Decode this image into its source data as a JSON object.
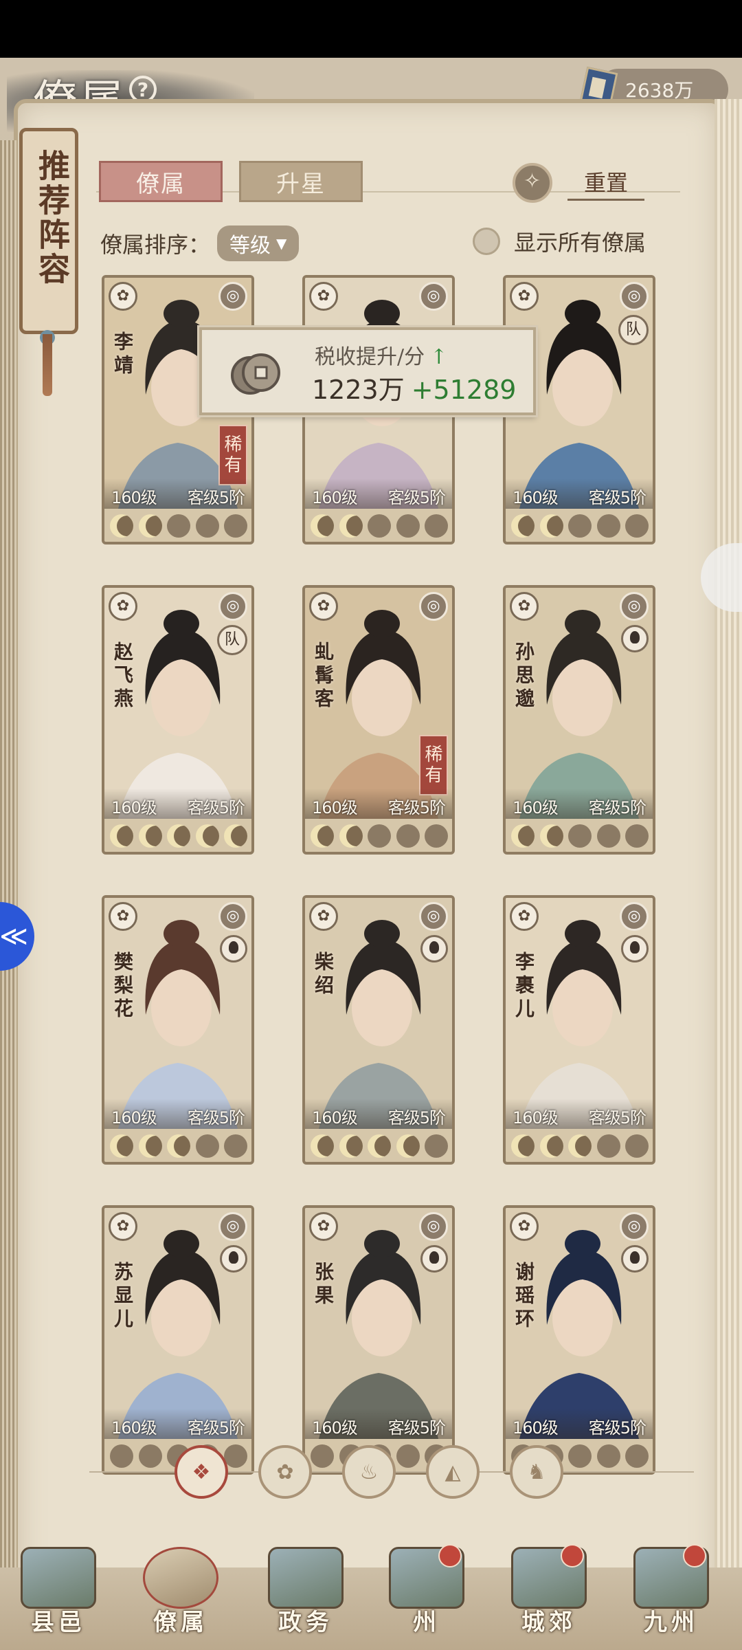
{
  "header": {
    "title": "僚属",
    "help": "?",
    "currency_value": "2638万"
  },
  "side_scroll": "推荐阵容",
  "tabs": [
    {
      "label": "僚属",
      "active": true
    },
    {
      "label": "升星",
      "active": false
    }
  ],
  "reset_label": "重置",
  "sort": {
    "label": "僚属排序：",
    "value": "等级"
  },
  "show_all_label": "显示所有僚属",
  "tooltip": {
    "label": "税收提升/分",
    "value": "1223万",
    "delta": "+51289"
  },
  "badges": {
    "rare": "稀有",
    "team": "队"
  },
  "cards": [
    {
      "name": "李靖",
      "level": "160级",
      "rank": "客级5阶",
      "stars": 2,
      "rare": true,
      "team": false,
      "avatar": false
    },
    {
      "name": "",
      "level": "160级",
      "rank": "客级5阶",
      "stars": 2,
      "rare": false,
      "team": false,
      "avatar": false
    },
    {
      "name": "",
      "level": "160级",
      "rank": "客级5阶",
      "stars": 2,
      "rare": false,
      "team": true,
      "avatar": false
    },
    {
      "name": "赵飞燕",
      "level": "160级",
      "rank": "客级5阶",
      "stars": 5,
      "rare": false,
      "team": true,
      "avatar": false
    },
    {
      "name": "虬髯客",
      "level": "160级",
      "rank": "客级5阶",
      "stars": 2,
      "rare": true,
      "team": false,
      "avatar": false
    },
    {
      "name": "孙思邈",
      "level": "160级",
      "rank": "客级5阶",
      "stars": 2,
      "rare": false,
      "team": false,
      "avatar": true
    },
    {
      "name": "樊梨花",
      "level": "160级",
      "rank": "客级5阶",
      "stars": 3,
      "rare": false,
      "team": false,
      "avatar": true
    },
    {
      "name": "柴绍",
      "level": "160级",
      "rank": "客级5阶",
      "stars": 4,
      "rare": false,
      "team": false,
      "avatar": true
    },
    {
      "name": "李裹儿",
      "level": "160级",
      "rank": "客级5阶",
      "stars": 3,
      "rare": false,
      "team": false,
      "avatar": true
    },
    {
      "name": "苏显儿",
      "level": "160级",
      "rank": "客级5阶",
      "stars": 0,
      "rare": false,
      "team": false,
      "avatar": true
    },
    {
      "name": "张果",
      "level": "160级",
      "rank": "客级5阶",
      "stars": 0,
      "rare": false,
      "team": false,
      "avatar": true
    },
    {
      "name": "谢瑶环",
      "level": "160级",
      "rank": "客级5阶",
      "stars": 0,
      "rare": false,
      "team": false,
      "avatar": true
    }
  ],
  "card_class_icons": [
    "flower-icon",
    "fan-icon",
    "lotus-icon",
    "fan-icon",
    "gourd-icon",
    "lion-icon",
    "fan-icon",
    "lion-icon",
    "lion-icon",
    "gourd-icon",
    "gourd-icon",
    "lotus-icon"
  ],
  "card_skill_icons": [
    "shield-icon",
    "mask-icon",
    "yinyang-icon",
    "sword-icon",
    "shield-icon",
    "mask-icon",
    "shield-icon",
    "sword-icon",
    "yinyang-icon",
    "sword-icon",
    "yinyang-icon",
    "sword-icon"
  ],
  "filters": [
    "all-icon",
    "lotus-icon",
    "gourd-icon",
    "fan-icon",
    "lion-icon"
  ],
  "nav": [
    {
      "label": "县邑",
      "active": false,
      "dot": false
    },
    {
      "label": "僚属",
      "active": true,
      "dot": false
    },
    {
      "label": "政务",
      "active": false,
      "dot": false
    },
    {
      "label": "州",
      "active": false,
      "dot": true
    },
    {
      "label": "城郊",
      "active": false,
      "dot": true
    },
    {
      "label": "九州",
      "active": false,
      "dot": true
    }
  ],
  "colors": {
    "accent_red": "#a8493d",
    "tab_active": "#c89188",
    "tooltip_delta": "#2e7d32"
  }
}
